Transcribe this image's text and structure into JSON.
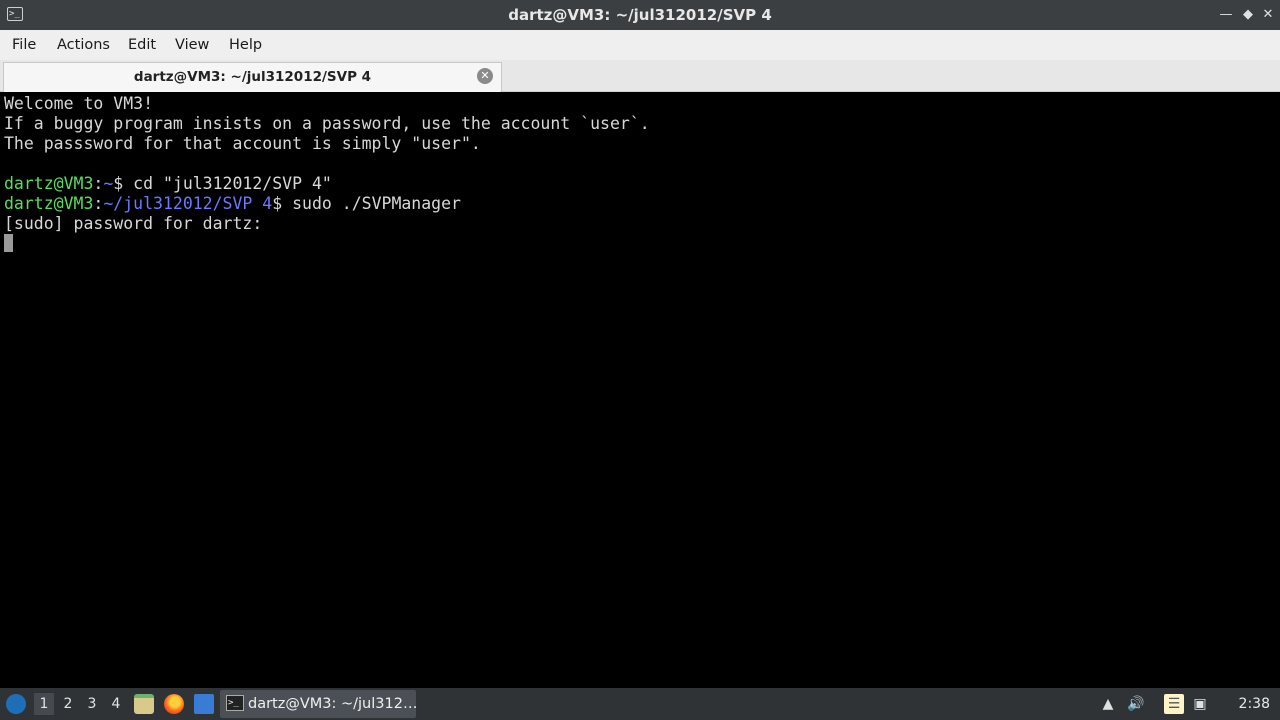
{
  "window": {
    "title": "dartz@VM3: ~/jul312012/SVP 4",
    "icon": "terminal-icon",
    "controls": [
      "minimize-icon",
      "restore-icon",
      "close-icon"
    ]
  },
  "menu": {
    "file": "File",
    "actions": "Actions",
    "edit": "Edit",
    "view": "View",
    "help": "Help"
  },
  "tab": {
    "label": "dartz@VM3: ~/jul312012/SVP 4",
    "close_icon": "close-circle-icon"
  },
  "terminal": {
    "line1": "Welcome to VM3!",
    "line2": "If a buggy program insists on a password, use the account `user`.",
    "line3": "The passsword for that account is simply \"user\".",
    "prompt1_user": "dartz@VM3",
    "prompt1_sep": ":",
    "prompt1_path": "~",
    "prompt1_cmd": "$ cd \"jul312012/SVP 4\"",
    "prompt2_user": "dartz@VM3",
    "prompt2_sep": ":",
    "prompt2_path": "~/jul312012/SVP 4",
    "prompt2_cmd": "$ sudo ./SVPManager",
    "line6": "[sudo] password for dartz:",
    "colors": {
      "user": "#55e05a",
      "path": "#6b78ff",
      "text": "#d8d8d8",
      "bg": "#000000"
    }
  },
  "taskbar": {
    "desktops": [
      "1",
      "2",
      "3",
      "4"
    ],
    "active_desktop": "1",
    "launchers": [
      "start-menu-icon",
      "file-manager-icon",
      "firefox-icon",
      "show-desktop-icon"
    ],
    "window_label": "dartz@VM3: ~/jul312…",
    "tray": [
      "update-notifier-icon",
      "volume-icon",
      "clipboard-icon",
      "network-icon"
    ],
    "clock": "2:38"
  }
}
